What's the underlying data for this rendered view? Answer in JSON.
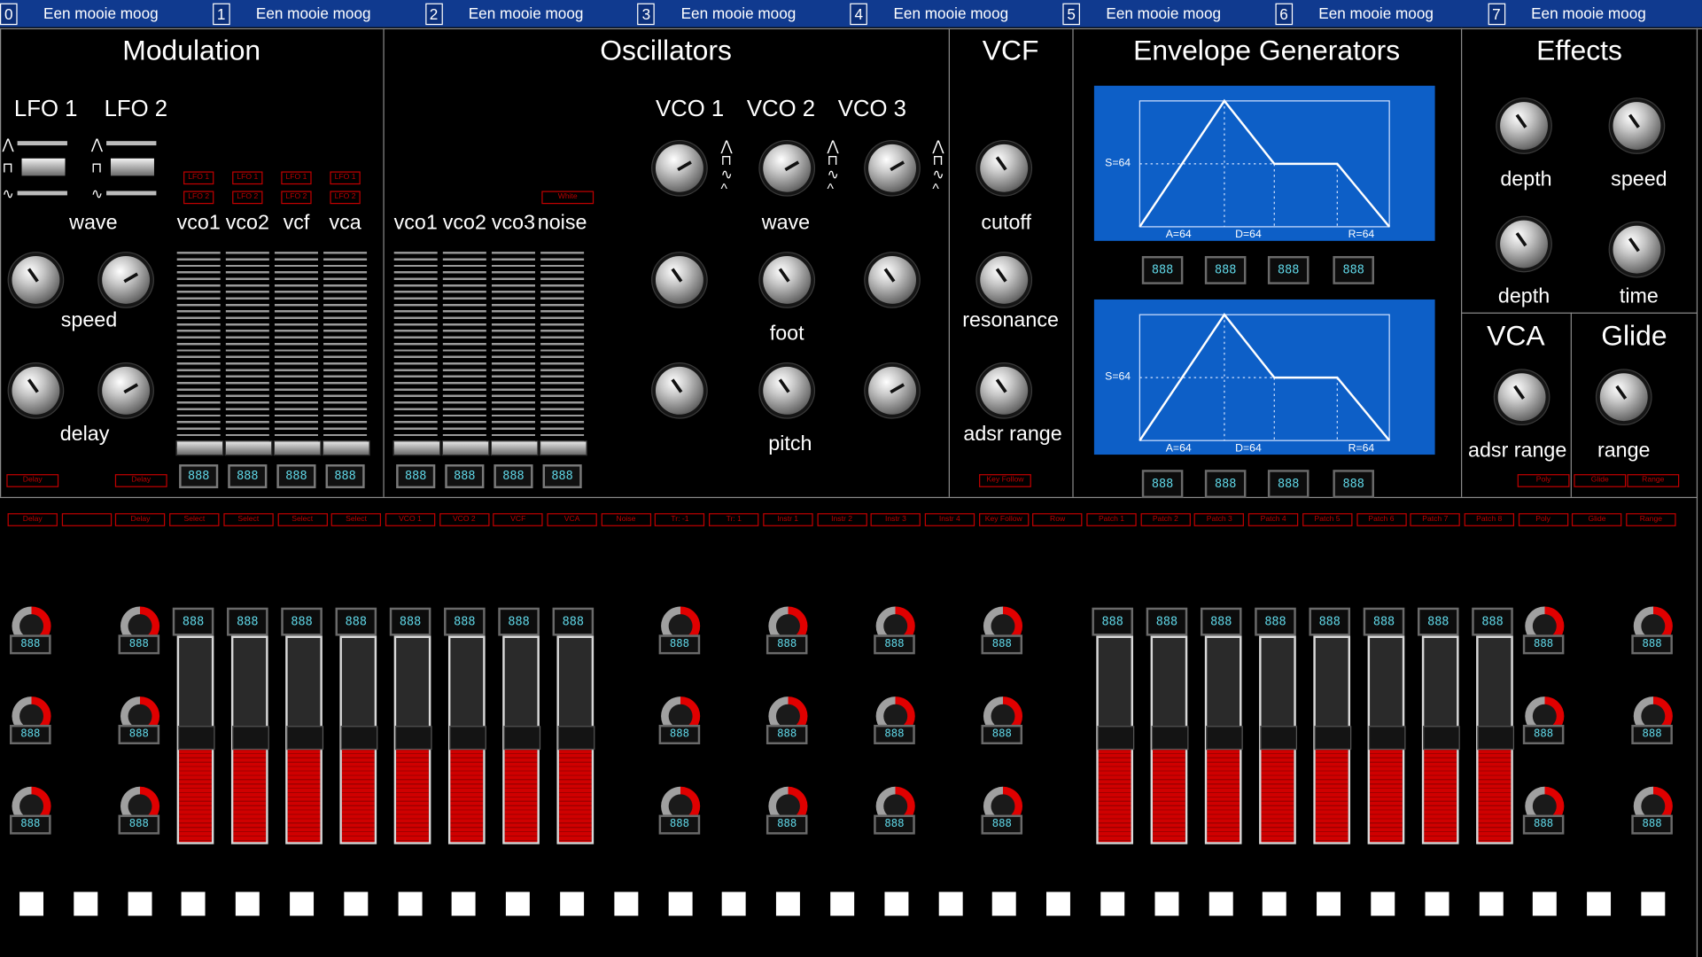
{
  "tabs": [
    {
      "num": "0",
      "label": "Een mooie moog"
    },
    {
      "num": "1",
      "label": "Een mooie moog"
    },
    {
      "num": "2",
      "label": "Een mooie moog"
    },
    {
      "num": "3",
      "label": "Een mooie moog"
    },
    {
      "num": "4",
      "label": "Een mooie moog"
    },
    {
      "num": "5",
      "label": "Een mooie moog"
    },
    {
      "num": "6",
      "label": "Een mooie moog"
    },
    {
      "num": "7",
      "label": "Een mooie moog"
    }
  ],
  "sections": {
    "modulation": "Modulation",
    "oscillators": "Oscillators",
    "vcf": "VCF",
    "envelope": "Envelope Generators",
    "effects": "Effects",
    "vca": "VCA",
    "glide": "Glide"
  },
  "modulation": {
    "lfo1": "LFO 1",
    "lfo2": "LFO 2",
    "wave": "wave",
    "speed": "speed",
    "delay": "delay",
    "mix_labels": [
      "vco1",
      "vco2",
      "vcf",
      "vca"
    ],
    "lfo1_tag": "LFO 1",
    "lfo2_tag": "LFO 2",
    "delay_btn": "Delay"
  },
  "oscillators": {
    "vco1": "VCO 1",
    "vco2": "VCO 2",
    "vco3": "VCO 3",
    "mix_labels": [
      "vco1",
      "vco2",
      "vco3",
      "noise"
    ],
    "white_tag": "White",
    "wave": "wave",
    "foot": "foot",
    "pitch": "pitch"
  },
  "vcf": {
    "cutoff": "cutoff",
    "resonance": "resonance",
    "adsr_range": "adsr range",
    "key_follow": "Key Follow"
  },
  "envelope": {
    "s_label": "S=64",
    "a_label": "A=64",
    "d_label": "D=64",
    "r_label": "R=64"
  },
  "effects": {
    "depth1": "depth",
    "speed": "speed",
    "depth2": "depth",
    "time": "time"
  },
  "vca": {
    "adsr_range": "adsr range",
    "poly": "Poly"
  },
  "glide": {
    "range": "range",
    "glide_btn": "Glide",
    "range_btn": "Range"
  },
  "lcd_text": "888",
  "bottom_buttons": [
    "Delay",
    "",
    "Delay",
    "Select",
    "Select",
    "Select",
    "Select",
    "VCO 1",
    "VCO 2",
    "VCF",
    "VCA",
    "Noise",
    "Tr: -1",
    "Tr: 1",
    "Instr 1",
    "Instr 2",
    "Instr 3",
    "Instr 4",
    "Key Follow",
    "Row",
    "Patch 1",
    "Patch 2",
    "Patch 3",
    "Patch 4",
    "Patch 5",
    "Patch 6",
    "Patch 7",
    "Patch 8",
    "Poly",
    "Glide",
    "Range"
  ],
  "bottom_fader_levels": [
    0.45,
    0.45,
    0.45,
    0.45,
    0.45,
    0.45,
    0.45,
    0.45,
    0.45,
    0.45,
    0.45,
    0.45,
    0.45,
    0.45,
    0.45,
    0.45
  ],
  "colors": {
    "tabbar": "#103a8f",
    "envelope_bg": "#0d5fc7",
    "accent_red": "#e00000",
    "lcd_cyan": "#5fd6e6"
  }
}
